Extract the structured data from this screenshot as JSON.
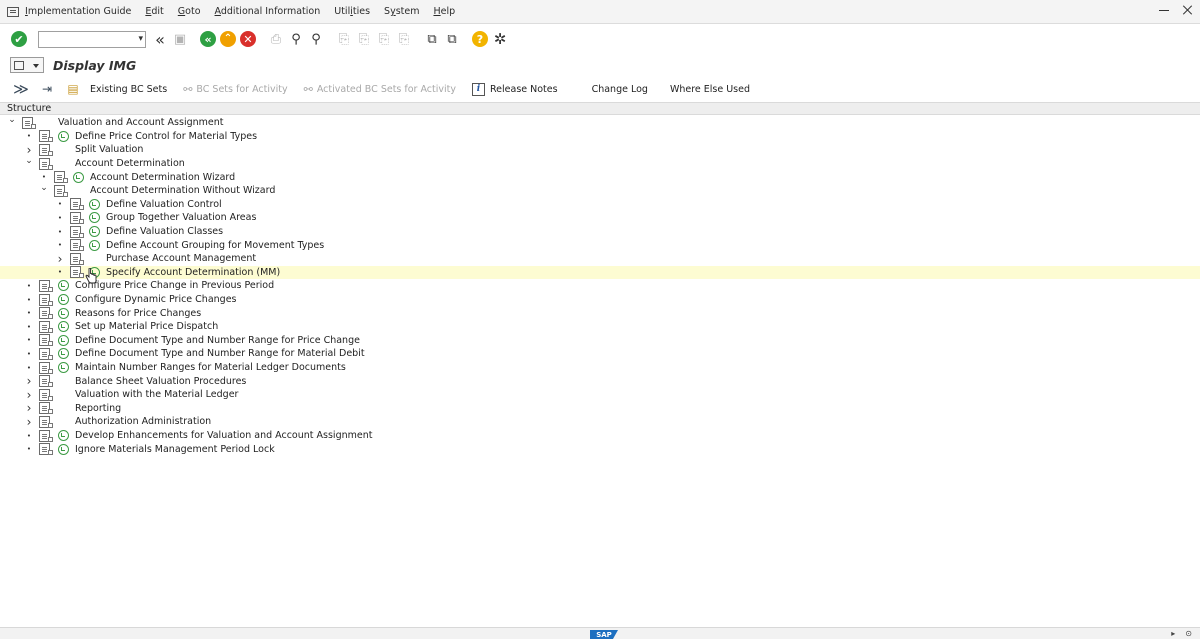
{
  "menu": {
    "items": [
      {
        "pre": "",
        "u": "I",
        "post": "mplementation Guide"
      },
      {
        "pre": "",
        "u": "E",
        "post": "dit"
      },
      {
        "pre": "",
        "u": "G",
        "post": "oto"
      },
      {
        "pre": "",
        "u": "A",
        "post": "dditional Information"
      },
      {
        "pre": "Util",
        "u": "i",
        "post": "ties"
      },
      {
        "pre": "S",
        "u": "y",
        "post": "stem"
      },
      {
        "pre": "",
        "u": "H",
        "post": "elp"
      }
    ]
  },
  "toolbar": {
    "command_value": "",
    "check_glyph": "✔",
    "back_glyph": "«",
    "nav_back": "«",
    "nav_up": "⌃",
    "nav_cancel": "✕",
    "help_glyph": "?",
    "settings_glyph": "✲"
  },
  "title": "Display IMG",
  "app_toolbar": {
    "existing_bc_sets": "Existing BC Sets",
    "bc_sets_for_activity": "BC Sets for Activity",
    "activated_bc_sets": "Activated BC Sets for Activity",
    "release_notes": "Release Notes",
    "info_glyph": "i",
    "change_log": "Change Log",
    "where_else_used": "Where Else Used"
  },
  "structure_label": "Structure",
  "tree": [
    {
      "label": "Valuation and Account Assignment",
      "level": 0,
      "exp": "down",
      "exec": false
    },
    {
      "label": "Define Price Control for Material Types",
      "level": 1,
      "exp": "dot",
      "exec": true
    },
    {
      "label": "Split Valuation",
      "level": 1,
      "exp": "right",
      "exec": false
    },
    {
      "label": "Account Determination",
      "level": 1,
      "exp": "down",
      "exec": false
    },
    {
      "label": "Account Determination Wizard",
      "level": 2,
      "exp": "dot",
      "exec": true
    },
    {
      "label": "Account Determination Without Wizard",
      "level": 2,
      "exp": "down",
      "exec": false
    },
    {
      "label": "Define Valuation Control",
      "level": 3,
      "exp": "dot",
      "exec": true
    },
    {
      "label": "Group Together Valuation Areas",
      "level": 3,
      "exp": "dot",
      "exec": true
    },
    {
      "label": "Define Valuation Classes",
      "level": 3,
      "exp": "dot",
      "exec": true
    },
    {
      "label": "Define Account Grouping for Movement Types",
      "level": 3,
      "exp": "dot",
      "exec": true
    },
    {
      "label": "Purchase Account Management",
      "level": 3,
      "exp": "right",
      "exec": false
    },
    {
      "label": "Specify Account Determination (MM)",
      "level": 3,
      "exp": "dot",
      "exec": true,
      "highlight": true
    },
    {
      "label": "Configure Price Change in Previous Period",
      "level": 1,
      "exp": "dot",
      "exec": true
    },
    {
      "label": "Configure Dynamic Price Changes",
      "level": 1,
      "exp": "dot",
      "exec": true
    },
    {
      "label": "Reasons for Price Changes",
      "level": 1,
      "exp": "dot",
      "exec": true
    },
    {
      "label": "Set up Material Price Dispatch",
      "level": 1,
      "exp": "dot",
      "exec": true
    },
    {
      "label": "Define Document Type and Number Range for Price Change",
      "level": 1,
      "exp": "dot",
      "exec": true
    },
    {
      "label": "Define Document Type and Number Range for Material Debit",
      "level": 1,
      "exp": "dot",
      "exec": true
    },
    {
      "label": "Maintain Number Ranges for Material Ledger Documents",
      "level": 1,
      "exp": "dot",
      "exec": true
    },
    {
      "label": "Balance Sheet Valuation Procedures",
      "level": 1,
      "exp": "right",
      "exec": false
    },
    {
      "label": "Valuation with the Material Ledger",
      "level": 1,
      "exp": "right",
      "exec": false
    },
    {
      "label": "Reporting",
      "level": 1,
      "exp": "right",
      "exec": false
    },
    {
      "label": "Authorization Administration",
      "level": 1,
      "exp": "right",
      "exec": false
    },
    {
      "label": "Develop Enhancements for Valuation and Account Assignment",
      "level": 1,
      "exp": "dot",
      "exec": true
    },
    {
      "label": "Ignore Materials Management Period Lock",
      "level": 1,
      "exp": "dot",
      "exec": true
    }
  ],
  "status": {
    "logo": "SAP"
  }
}
